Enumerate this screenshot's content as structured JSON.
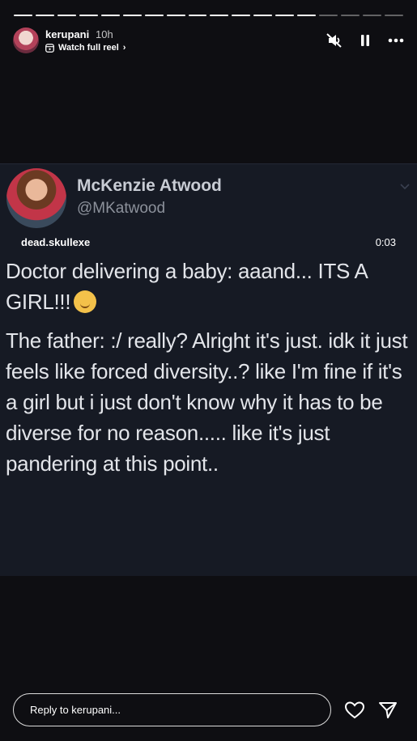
{
  "story": {
    "progress_segments_total": 18,
    "progress_segments_done": 14
  },
  "header": {
    "username": "kerupani",
    "time_ago": "10h",
    "reel_link": "Watch full reel",
    "controls": [
      "mute-icon",
      "pause-icon",
      "more-icon"
    ]
  },
  "post": {
    "author_name": "McKenzie Atwood",
    "author_handle": "@MKatwood",
    "source_account": "dead.skullexe",
    "duration": "0:03",
    "line1": "Doctor delivering a baby: aaand... ITS A GIRL!!!",
    "line2": "The father: :/ really? Alright it's just. idk it just feels like forced diversity..? like I'm fine if it's a girl but i just don't know why it has to be diverse for no reason..... like it's just pandering at this point.."
  },
  "footer": {
    "reply_placeholder": "Reply to kerupani..."
  },
  "colors": {
    "background": "#0e0e12",
    "post_background": "#161a24",
    "text": "#e3e5ea",
    "handle": "#8c919b"
  }
}
